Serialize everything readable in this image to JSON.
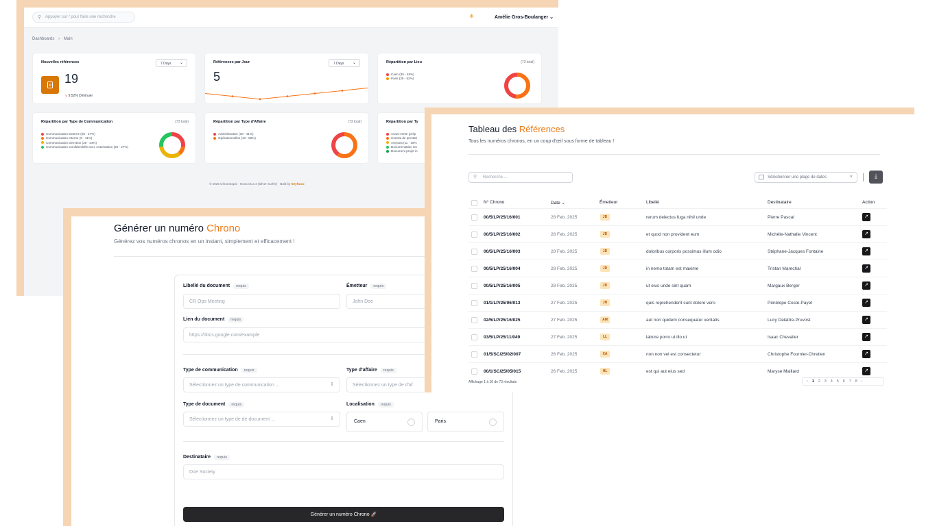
{
  "dashboard": {
    "search_placeholder": "Appuyer sur / pour faire une recherche",
    "user_name": "Amélie Gros-Boulanger",
    "breadcrumb": [
      "Dashboards",
      "Main"
    ],
    "breadcrumb_sep": "›",
    "period_label": "7 Days",
    "cards": {
      "nouvelles": {
        "title": "Nouvelles références",
        "value": "19",
        "trend": "9.52% Diminuer"
      },
      "par_jour": {
        "title": "Références par Jour",
        "value": "5",
        "sparkline": [
          6,
          5,
          4,
          5,
          6,
          7,
          8
        ]
      },
      "par_lieu": {
        "title": "Répartition par Lieu",
        "total": "(73 total)",
        "items": [
          "Caen (35 - 48%)",
          "Paris (38 - 52%)"
        ]
      },
      "par_comm": {
        "title": "Répartition par Type de Communication",
        "total": "(73 total)",
        "items": [
          "Communication Externe (20 - 27%)",
          "Communication Interne (8 - 11%)",
          "Communication Direction (25 - 34%)",
          "Communication Confidentielle avec Autorisation (20 - 27%)"
        ]
      },
      "par_affaire": {
        "title": "Répartition par Type d'Affaire",
        "total": "(73 total)",
        "items": [
          "Administrative (30 - 41%)",
          "Opérationnelles (43 - 59%)"
        ]
      },
      "par_type": {
        "title": "Répartition par Ty",
        "items": [
          "Avant-vente (prép",
          "Contrat de prestati",
          "Avenant (11 - 15%",
          "Documentation tec",
          "Document projet in"
        ]
      }
    },
    "footer_prefix": "© 2025 Chronotopic · Nova v5.2.4 (Silver Surfer) · Built by",
    "footer_brand": "Seyhuco",
    "colors": {
      "orange": "#f97316",
      "amber": "#f59e0b",
      "red": "#ef4444",
      "green": "#22c55e",
      "yellow": "#eab308"
    }
  },
  "form": {
    "title_prefix": "Générer un numéro",
    "title_accent": "Chrono",
    "subtitle": "Générez vos numéros chronos en un instant, simplement et efficacement !",
    "required_tag": "requis",
    "fields": {
      "libelle": {
        "label": "Libellé du document",
        "placeholder": "CR Ops Meeting"
      },
      "emetteur": {
        "label": "Émetteur",
        "placeholder": "John Doe"
      },
      "lien": {
        "label": "Lien du document",
        "placeholder": "https://docs.google.com/example"
      },
      "type_comm": {
        "label": "Type de communication",
        "placeholder": "Sélectionnez un type de communication ..."
      },
      "type_affaire": {
        "label": "Type d'affaire",
        "placeholder": "Sélectionnez un type de d'af"
      },
      "type_doc": {
        "label": "Type de document",
        "placeholder": "Sélectionnez un type de de document ..."
      },
      "localisation": {
        "label": "Localisation",
        "options": [
          "Caen",
          "Paris"
        ]
      },
      "destinataire": {
        "label": "Destinataire",
        "placeholder": "Doe Society"
      }
    },
    "submit_label": "Générer un numéro Chrono 🚀"
  },
  "table": {
    "title_prefix": "Tableau des",
    "title_accent": "Références",
    "subtitle": "Tous les numéros chronos, en un coup d'œil sous forme de tableau !",
    "search_placeholder": "Recherche ...",
    "date_placeholder": "Sélectionner une plage de dates",
    "columns": [
      "N° Chrono",
      "Date ⌄",
      "Émetteur",
      "Libellé",
      "Destinataire",
      "Action"
    ],
    "rows": [
      {
        "num": "00/5/LP/25/16/001",
        "date": "28 Feb. 2025",
        "emetteur": "JD",
        "libelle": "rerum delectus fuga nihil unde",
        "destinataire": "Pierre Pascal"
      },
      {
        "num": "00/5/LP/25/16/002",
        "date": "28 Feb. 2025",
        "emetteur": "JD",
        "libelle": "et quod non provident eum",
        "destinataire": "Michèle-Nathalie Vincent"
      },
      {
        "num": "00/5/LP/25/16/003",
        "date": "28 Feb. 2025",
        "emetteur": "JD",
        "libelle": "doloribus corporis possimus illum odio",
        "destinataire": "Stéphane-Jacques Fontaine"
      },
      {
        "num": "00/5/LP/25/16/004",
        "date": "28 Feb. 2025",
        "emetteur": "JD",
        "libelle": "in nemo totam est maxime",
        "destinataire": "Tristan Marechal"
      },
      {
        "num": "00/5/LP/25/16/005",
        "date": "28 Feb. 2025",
        "emetteur": "JD",
        "libelle": "ut eius unde sint quam",
        "destinataire": "Margaux Berger"
      },
      {
        "num": "01/1/LP/25/06/013",
        "date": "27 Feb. 2025",
        "emetteur": "JH",
        "libelle": "quis reprehenderit sunt dolore vero",
        "destinataire": "Pénélope Coste-Payet"
      },
      {
        "num": "02/5/LP/25/16/025",
        "date": "27 Feb. 2025",
        "emetteur": "AM",
        "libelle": "aut non quidem consequatur veritatis",
        "destinataire": "Lucy Delattre-Pruvost"
      },
      {
        "num": "03/5/LP/25/11/049",
        "date": "27 Feb. 2025",
        "emetteur": "LL",
        "libelle": "labore porro ut illo ut",
        "destinataire": "Isaac Chevalier"
      },
      {
        "num": "01/5/SC/25/02/007",
        "date": "26 Feb. 2025",
        "emetteur": "XA",
        "libelle": "non non vel est consectetur",
        "destinataire": "Christophe Fournier-Chretien"
      },
      {
        "num": "00/1/SC/25/05/015",
        "date": "26 Feb. 2025",
        "emetteur": "HL",
        "libelle": "est qui aut eius sed",
        "destinataire": "Maryse Maillard"
      }
    ],
    "footer": "Affichage 1 à 10 de 73 résultats",
    "pager": {
      "prev": "‹",
      "current": "1",
      "pages": "2 3 4 5 6 7 8",
      "next": "›"
    }
  }
}
